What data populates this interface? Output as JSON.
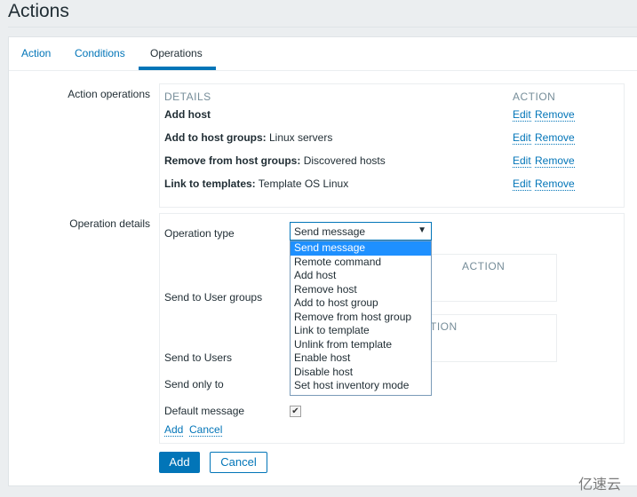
{
  "page": {
    "title": "Actions"
  },
  "tabs": [
    {
      "label": "Action",
      "active": false
    },
    {
      "label": "Conditions",
      "active": false
    },
    {
      "label": "Operations",
      "active": true
    }
  ],
  "action_operations": {
    "label": "Action operations",
    "columns": {
      "details": "DETAILS",
      "action": "ACTION"
    },
    "rows": [
      {
        "bold": "Add host",
        "value": "",
        "edit": "Edit",
        "remove": "Remove"
      },
      {
        "bold": "Add to host groups:",
        "value": " Linux servers",
        "edit": "Edit",
        "remove": "Remove"
      },
      {
        "bold": "Remove from host groups:",
        "value": " Discovered hosts",
        "edit": "Edit",
        "remove": "Remove"
      },
      {
        "bold": "Link to templates:",
        "value": " Template OS Linux",
        "edit": "Edit",
        "remove": "Remove"
      }
    ]
  },
  "operation_details": {
    "label": "Operation details",
    "operation_type_label": "Operation type",
    "operation_type_value": "Send message",
    "operation_type_options": [
      "Send message",
      "Remote command",
      "Add host",
      "Remove host",
      "Add to host group",
      "Remove from host group",
      "Link to template",
      "Unlink from template",
      "Enable host",
      "Disable host",
      "Set host inventory mode"
    ],
    "send_to_user_groups_label": "Send to User groups",
    "user_groups_action_header": "ACTION",
    "users_action_header_partial": "TION",
    "send_to_users_label": "Send to Users",
    "send_only_to_label": "Send only to",
    "default_message_label": "Default message",
    "default_message_checked": true,
    "add_link": "Add",
    "cancel_link": "Cancel"
  },
  "footer": {
    "add_button": "Add",
    "cancel_button": "Cancel"
  },
  "watermark": "亿速云"
}
